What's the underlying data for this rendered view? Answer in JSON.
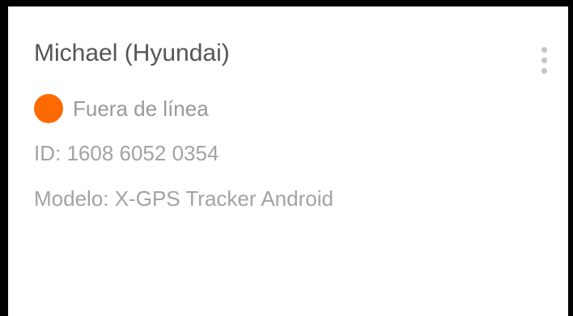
{
  "device": {
    "name": "Michael (Hyundai)",
    "status": {
      "label": "Fuera de línea",
      "color": "#ff6a00"
    },
    "id_line": "ID: 1608 6052 0354",
    "model_line": "Modelo: X-GPS Tracker Android"
  },
  "menu": {
    "icon": "more-vertical-icon"
  }
}
